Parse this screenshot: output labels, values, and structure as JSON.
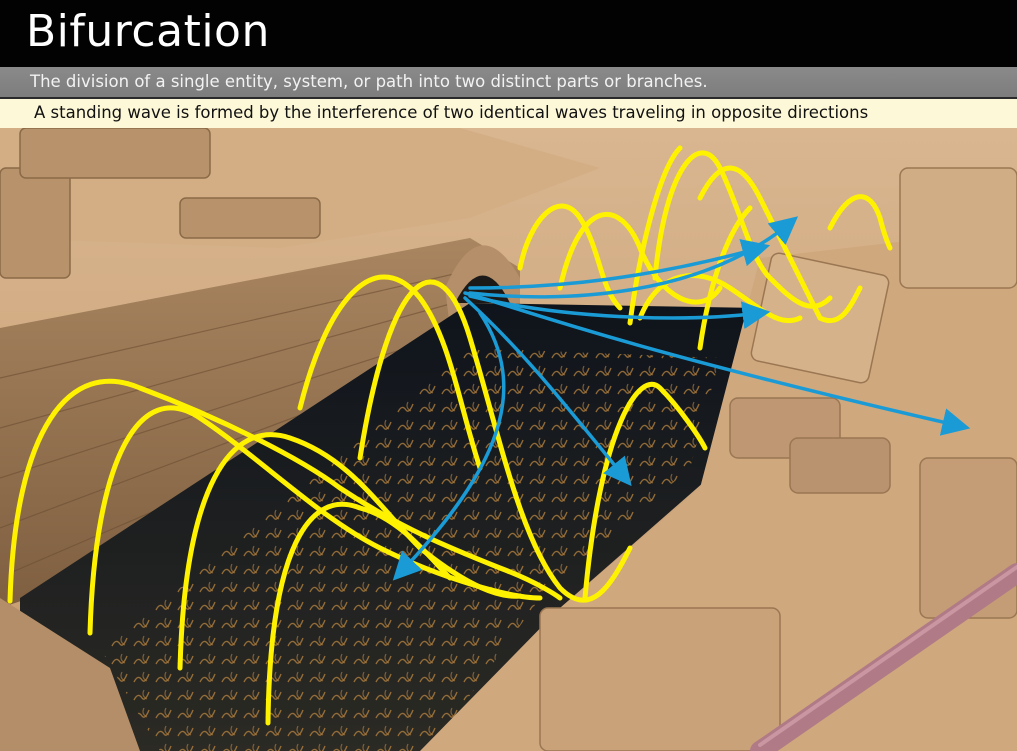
{
  "header": {
    "title": "Bifurcation",
    "definition": "The division of a single entity, system, or path into two distinct parts or branches.",
    "caption": "A standing wave is formed by the interference of two identical waves traveling in opposite directions"
  },
  "colors": {
    "title_bg": "#020202",
    "subtitle_bg": "#828282",
    "caption_bg": "#fdf8d8",
    "wave_stroke": "#fff200",
    "arrow_stroke": "#1b9bd6",
    "stone": "#c9a47c",
    "water": "#1a1f28"
  }
}
